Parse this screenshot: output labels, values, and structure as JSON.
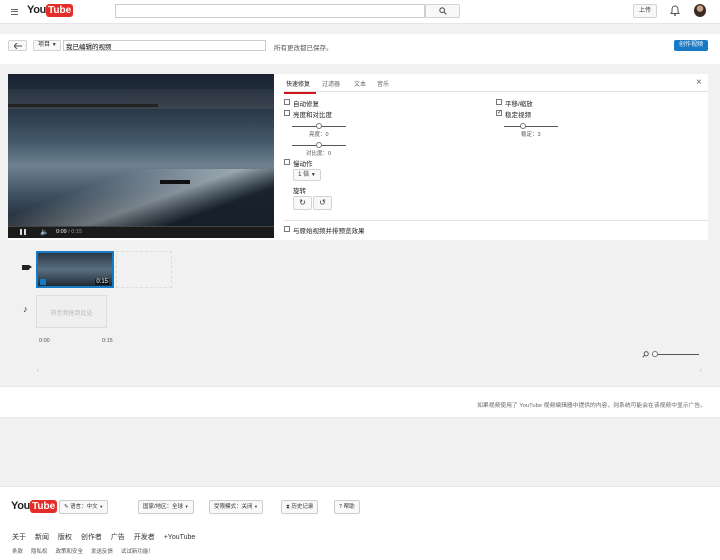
{
  "header": {
    "logo_you": "You",
    "logo_tube": "Tube",
    "search_placeholder": "",
    "upload_label": "上传"
  },
  "editbar": {
    "project_label": "项目",
    "title_value": "我已编辑的视频",
    "save_status": "所有更改都已保存。",
    "create_video_label": "创作视频"
  },
  "player": {
    "time_current": "0:09",
    "time_total": "/ 0:15"
  },
  "tabs": [
    "快速修复",
    "过滤器",
    "文本",
    "音乐"
  ],
  "quickfix": {
    "auto_fix": "自动修复",
    "brightness_contrast": "亮度和对比度",
    "brightness_label": "亮度：0",
    "contrast_label": "对比度：0",
    "slow_motion": "慢动作",
    "speed_value": "1 倍",
    "rotate": "旋转",
    "pan_zoom": "平移/缩放",
    "stabilize": "稳定视频",
    "stabilize_checked": true,
    "stable_label": "稳定：3",
    "side_by_side": "与原始视频并排预览效果"
  },
  "timeline": {
    "clip_duration": "0:15",
    "audio_placeholder": "将音频拖到此处",
    "time_start": "0:00",
    "time_end": "0:15"
  },
  "footer_note": "如果视频使用了 YouTube 视频编辑器中提供的内容，则系统可能会在该视频中显示广告。",
  "footer": {
    "language": "语言：中文",
    "country": "国家/地区：全球",
    "restricted": "受限模式：关闭",
    "history": "历史记录",
    "help": "帮助",
    "links": [
      "关于",
      "新闻",
      "版权",
      "创作者",
      "广告",
      "开发者",
      "+YouTube"
    ],
    "links2": [
      "条款",
      "隐私权",
      "政策和安全",
      "发送反馈",
      "试试新功能！"
    ]
  }
}
